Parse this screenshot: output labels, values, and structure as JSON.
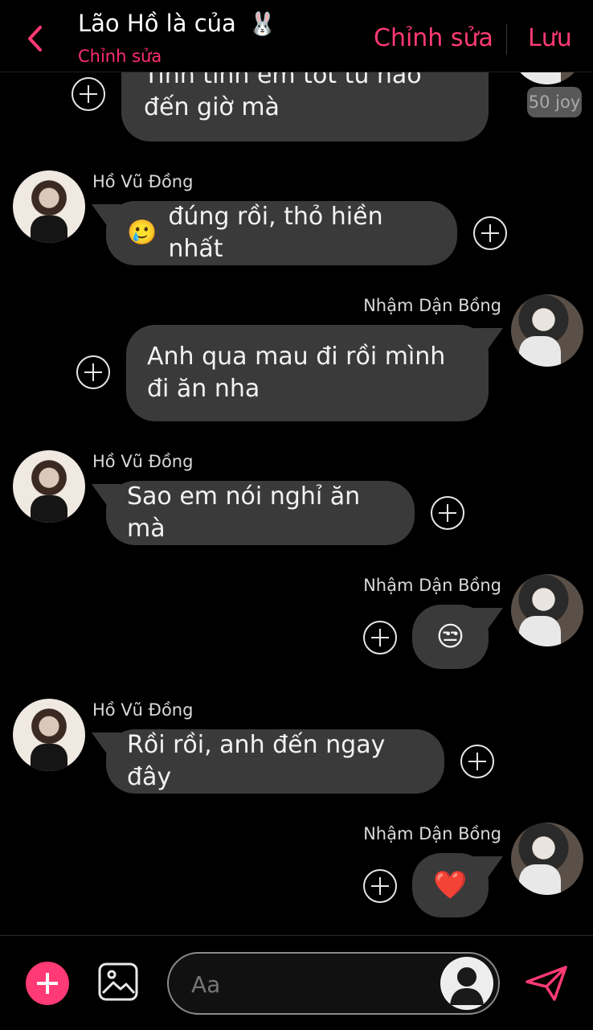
{
  "header": {
    "title": "Lão Hồ là của",
    "title_emoji": "🐰",
    "subtitle": "Chỉnh sửa",
    "edit_label": "Chỉnh sửa",
    "save_label": "Lưu"
  },
  "chat": {
    "partial_message": {
      "text": "Tinh tinh em tốt từ nào đến giờ mà",
      "joy": "50 joy"
    },
    "messages": [
      {
        "sender": "Hồ Vũ Đồng",
        "emoji": "🥲",
        "text": "đúng rồi, thỏ hiền nhất"
      },
      {
        "sender": "Nhậm Dận Bồng",
        "text": "Anh qua mau đi rồi mình đi ăn nha"
      },
      {
        "sender": "Hồ Vũ Đồng",
        "text": "Sao em nói nghỉ ăn mà"
      },
      {
        "sender": "Nhậm Dận Bồng",
        "text": "😒"
      },
      {
        "sender": "Hồ Vũ Đồng",
        "text": "Rồi rồi, anh đến ngay đây"
      },
      {
        "sender": "Nhậm Dận Bồng",
        "text": "❤️"
      }
    ]
  },
  "composer": {
    "placeholder": "Aa"
  },
  "colors": {
    "accent": "#ff3a74",
    "bubble": "#3a3a3a",
    "background": "#000000"
  },
  "icons": {
    "back": "chevron-left-icon",
    "add": "plus-icon",
    "image": "image-icon",
    "persona": "person-icon",
    "send": "send-icon"
  }
}
